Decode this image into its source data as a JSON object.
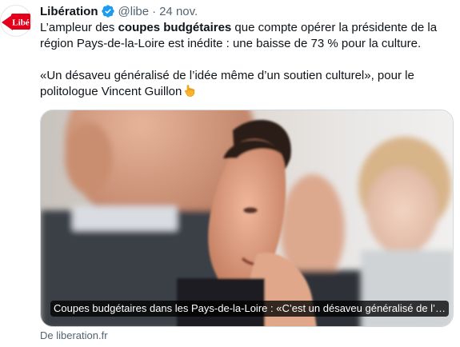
{
  "author": {
    "name": "Libération",
    "handle": "@libe",
    "separator": "·",
    "date": "24 nov.",
    "avatar_icon": "liberation-logo-icon",
    "verified_icon": "verified-badge-icon",
    "avatar_text": "Libé",
    "brand_red": "#e2001a"
  },
  "text": {
    "p1_before": "L’ampleur des ",
    "p1_bold": "coupes budgétaires",
    "p1_after": " que compte opérer la présidente de la région Pays-de-la-Loire est inédite : une baisse de 73 % pour la culture.",
    "p2": "«Un désaveu généralisé de l’idée même d’un soutien culturel», pour le politologue Vincent Guillon",
    "p2_emoji_icon": "pointing-down-hand-icon"
  },
  "card": {
    "caption": "Coupes budgétaires dans les Pays-de-la-Loire : «C’est un désaveu généralisé de l’idée même d’un soutien culturel»",
    "image_icon": "press-photo"
  },
  "source": {
    "label": "De liberation.fr"
  },
  "colors": {
    "text": "#0f1419",
    "muted": "#536471",
    "verified": "#1d9bf0",
    "border": "#cfd9de"
  }
}
